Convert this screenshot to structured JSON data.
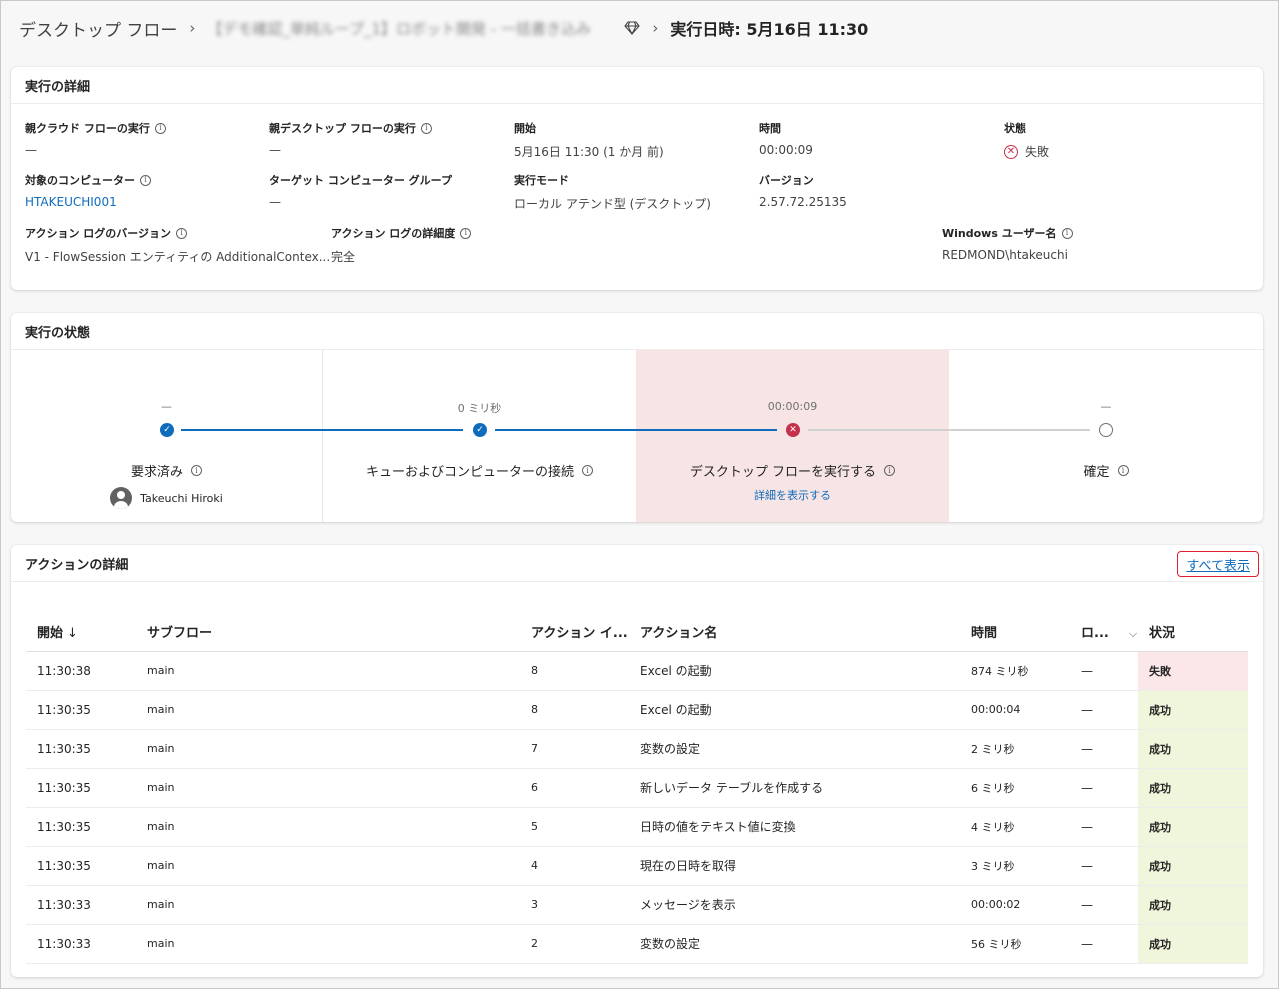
{
  "breadcrumb": {
    "root": "デスクトップ フロー",
    "flow_name": "【デモ確認_単純ループ_1】ロボット開発 - 一括書き込み",
    "current": "実行日時: 5月16日 11:30"
  },
  "details": {
    "title": "実行の詳細",
    "parent_cloud_flow": {
      "label": "親クラウド フローの実行",
      "value": "—"
    },
    "parent_desktop_flow": {
      "label": "親デスクトップ フローの実行",
      "value": "—"
    },
    "start": {
      "label": "開始",
      "value": "5月16日 11:30 (1 か月 前)"
    },
    "duration": {
      "label": "時間",
      "value": "00:00:09"
    },
    "status": {
      "label": "状態",
      "value": "失敗"
    },
    "target_computer": {
      "label": "対象のコンピューター",
      "value": "HTAKEUCHI001"
    },
    "target_group": {
      "label": "ターゲット コンピューター グループ",
      "value": "—"
    },
    "run_mode": {
      "label": "実行モード",
      "value": "ローカル アテンド型 (デスクトップ)"
    },
    "version": {
      "label": "バージョン",
      "value": "2.57.72.25135"
    },
    "action_log_version": {
      "label": "アクション ログのバージョン",
      "value": "V1 - FlowSession エンティティの AdditionalContex..."
    },
    "action_log_detail": {
      "label": "アクション ログの詳細度",
      "value": "完全"
    },
    "windows_user": {
      "label": "Windows ユーザー名",
      "value": "REDMOND\\htakeuchi"
    }
  },
  "run_status": {
    "title": "実行の状態",
    "steps": [
      {
        "duration": "—",
        "label": "要求済み",
        "sub": "Takeuchi Hiroki",
        "state": "done"
      },
      {
        "duration": "0 ミリ秒",
        "label": "キューおよびコンピューターの接続",
        "sub": "",
        "state": "done"
      },
      {
        "duration": "00:00:09",
        "label": "デスクトップ フローを実行する",
        "sub": "詳細を表示する",
        "state": "fail"
      },
      {
        "duration": "—",
        "label": "確定",
        "sub": "",
        "state": "todo"
      }
    ]
  },
  "actions": {
    "title": "アクションの詳細",
    "show_all": "すべて表示",
    "columns": {
      "start": "開始",
      "subflow": "サブフロー",
      "action_index": "アクション イ...",
      "action_name": "アクション名",
      "duration": "時間",
      "log": "ロ...",
      "status": "状況"
    },
    "rows": [
      {
        "start": "11:30:38",
        "subflow": "main",
        "index": "8",
        "name": "Excel の起動",
        "duration": "874 ミリ秒",
        "log": "—",
        "status": "失敗",
        "state": "fail"
      },
      {
        "start": "11:30:35",
        "subflow": "main",
        "index": "8",
        "name": "Excel の起動",
        "duration": "00:00:04",
        "log": "—",
        "status": "成功",
        "state": "ok"
      },
      {
        "start": "11:30:35",
        "subflow": "main",
        "index": "7",
        "name": "変数の設定",
        "duration": "2 ミリ秒",
        "log": "—",
        "status": "成功",
        "state": "ok"
      },
      {
        "start": "11:30:35",
        "subflow": "main",
        "index": "6",
        "name": "新しいデータ テーブルを作成する",
        "duration": "6 ミリ秒",
        "log": "—",
        "status": "成功",
        "state": "ok"
      },
      {
        "start": "11:30:35",
        "subflow": "main",
        "index": "5",
        "name": "日時の値をテキスト値に変換",
        "duration": "4 ミリ秒",
        "log": "—",
        "status": "成功",
        "state": "ok"
      },
      {
        "start": "11:30:35",
        "subflow": "main",
        "index": "4",
        "name": "現在の日時を取得",
        "duration": "3 ミリ秒",
        "log": "—",
        "status": "成功",
        "state": "ok"
      },
      {
        "start": "11:30:33",
        "subflow": "main",
        "index": "3",
        "name": "メッセージを表示",
        "duration": "00:00:02",
        "log": "—",
        "status": "成功",
        "state": "ok"
      },
      {
        "start": "11:30:33",
        "subflow": "main",
        "index": "2",
        "name": "変数の設定",
        "duration": "56 ミリ秒",
        "log": "—",
        "status": "成功",
        "state": "ok"
      }
    ]
  },
  "colors": {
    "accent": "#0f6cbd",
    "fail": "#c4314b",
    "fail_bg": "#fbe6e8",
    "ok_bg": "#f0f6db",
    "highlight_border": "#e0202c"
  },
  "icons": [
    "chevron-right-icon",
    "diamond-icon",
    "info-icon",
    "error-circle-icon",
    "checkmark-icon",
    "dismiss-icon",
    "avatar",
    "sort-down-icon",
    "chevron-down-icon"
  ]
}
